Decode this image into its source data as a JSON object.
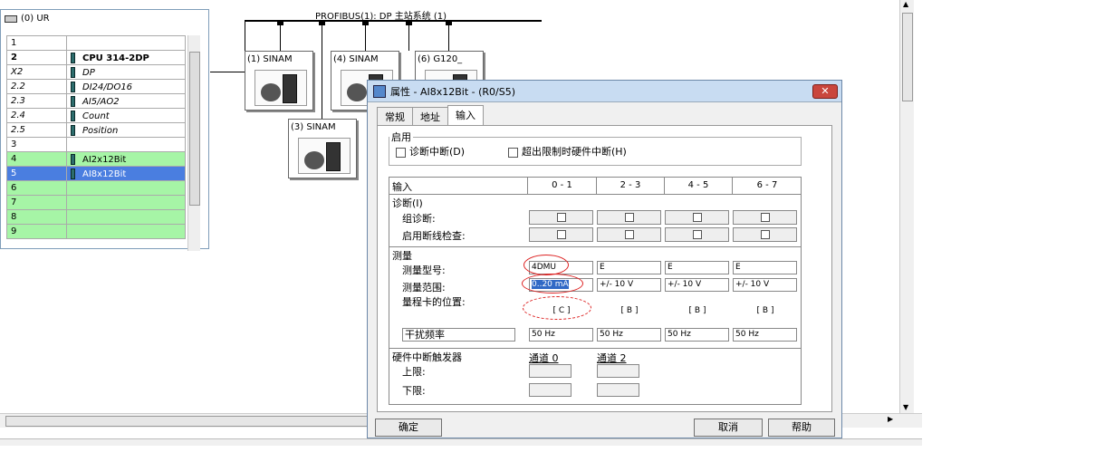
{
  "rack": {
    "title": "(0) UR",
    "rows": [
      {
        "slot": "1",
        "module": "",
        "style": ""
      },
      {
        "slot": "2",
        "module": "CPU 314-2DP",
        "style": "bold"
      },
      {
        "slot": "X2",
        "module": "DP",
        "style": "ital"
      },
      {
        "slot": "2.2",
        "module": "DI24/DO16",
        "style": "ital"
      },
      {
        "slot": "2.3",
        "module": "AI5/AO2",
        "style": "ital"
      },
      {
        "slot": "2.4",
        "module": "Count",
        "style": "ital"
      },
      {
        "slot": "2.5",
        "module": "Position",
        "style": "ital"
      },
      {
        "slot": "3",
        "module": "",
        "style": ""
      },
      {
        "slot": "4",
        "module": "AI2x12Bit",
        "style": "green"
      },
      {
        "slot": "5",
        "module": "AI8x12Bit",
        "style": "sel"
      },
      {
        "slot": "6",
        "module": "",
        "style": "green"
      },
      {
        "slot": "7",
        "module": "",
        "style": "green"
      },
      {
        "slot": "8",
        "module": "",
        "style": "green"
      },
      {
        "slot": "9",
        "module": "",
        "style": "green"
      }
    ]
  },
  "bus": {
    "label": "PROFIBUS(1): DP 主站系统 (1)"
  },
  "nodes": [
    "(1) SINAM",
    "(4) SINAM",
    "(6) G120_",
    "(3) SINAM"
  ],
  "dialog": {
    "title": "属性 - AI8x12Bit - (R0/S5)",
    "close": "✕",
    "tabs": [
      "常规",
      "地址",
      "输入"
    ],
    "enable": {
      "legend": "启用",
      "diag_interrupt": "诊断中断(D)",
      "hw_interrupt": "超出限制时硬件中断(H)"
    },
    "grid": {
      "input_label": "输入",
      "cols": [
        "0 - 1",
        "2 - 3",
        "4 - 5",
        "6 - 7"
      ],
      "diag_title": "诊断(I)",
      "group_diag": "组诊断:",
      "wire_break": "启用断线检查:",
      "measure_title": "测量",
      "measure_type": "测量型号:",
      "measure_range": "测量范围:",
      "range_card_pos": "量程卡的位置:",
      "types": [
        "4DMU",
        "E",
        "E",
        "E"
      ],
      "ranges": [
        "0..20 mA",
        "+/- 10 V",
        "+/- 10 V",
        "+/- 10 V"
      ],
      "positions": [
        "[ C ]",
        "[ B ]",
        "[ B ]",
        "[ B ]"
      ],
      "interference": "干扰频率",
      "freqs": [
        "50 Hz",
        "50 Hz",
        "50 Hz",
        "50 Hz"
      ],
      "hw_trigger": "硬件中断触发器",
      "channel0": "通道 0",
      "channel2": "通道 2",
      "upper": "上限:",
      "lower": "下限:"
    },
    "ok": "确定",
    "cancel": "取消",
    "help": "帮助"
  },
  "colors": {
    "accent": "#3169c6",
    "green_row": "#a6f5a6",
    "highlight_red": "#dd2222"
  }
}
